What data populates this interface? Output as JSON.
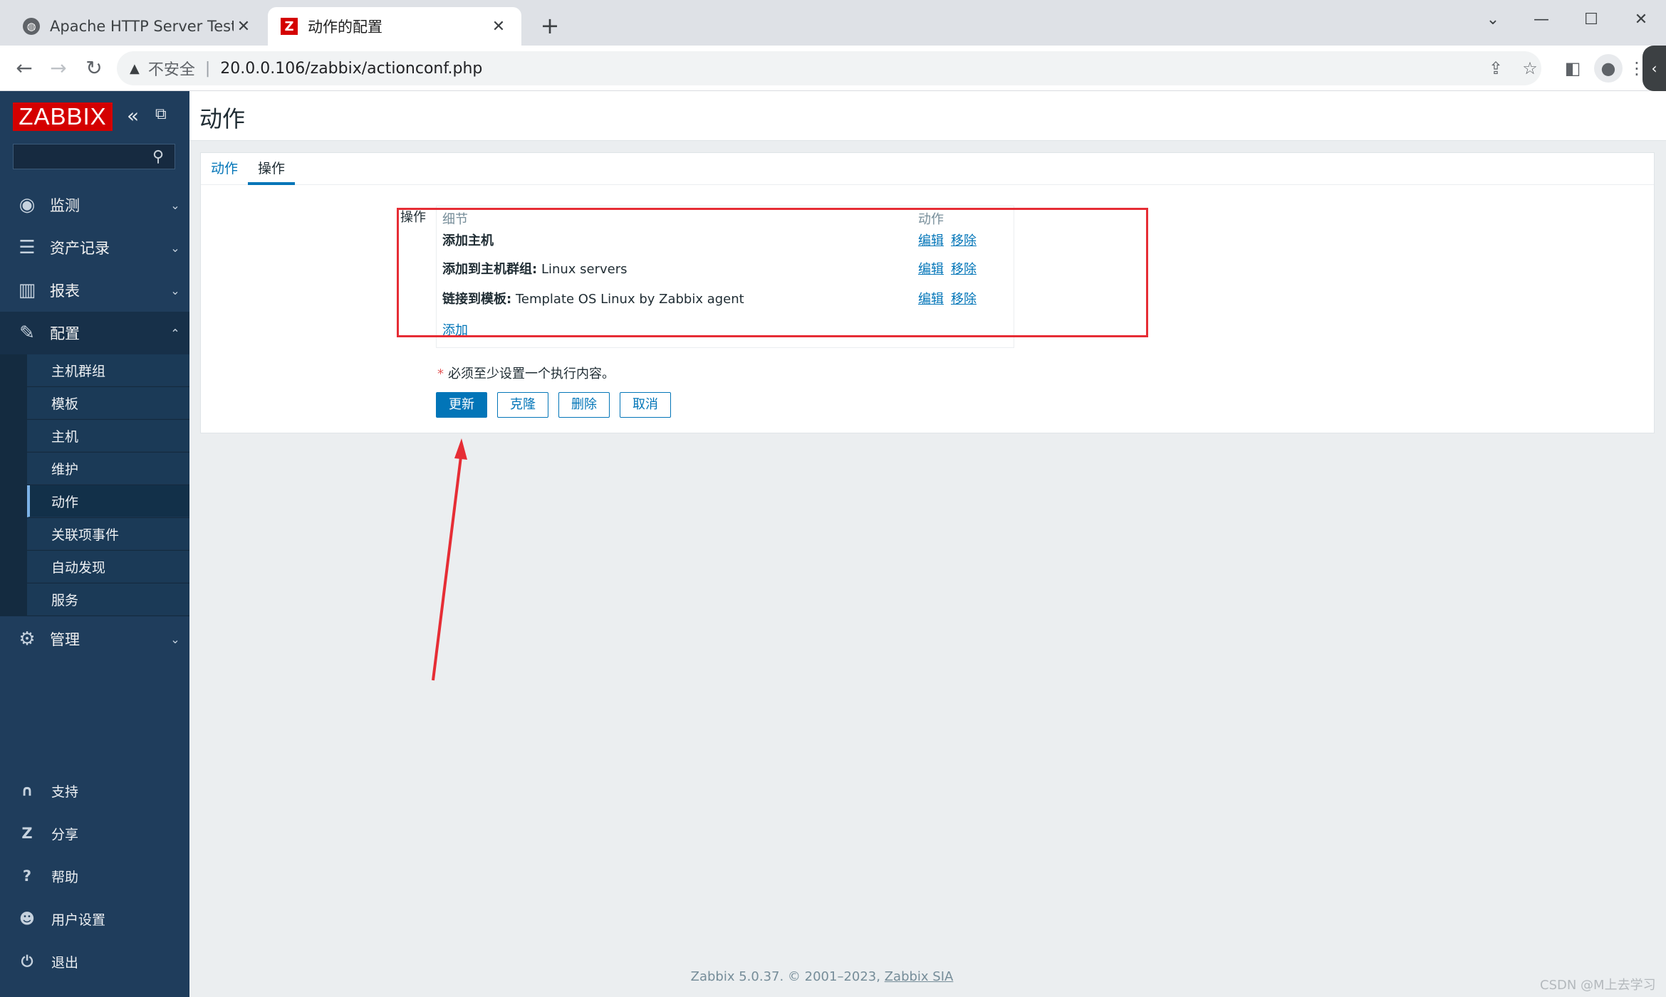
{
  "browser": {
    "tabs": [
      {
        "title": "Apache HTTP Server Test Page",
        "close": "✕"
      },
      {
        "title": "动作的配置",
        "close": "✕"
      }
    ],
    "new_tab": "+",
    "window_controls": {
      "minimize": "—",
      "maximize": "☐",
      "close": "✕",
      "dropdown": "⌄"
    },
    "address": {
      "warning_icon": "▲",
      "security": "不安全",
      "separator": "|",
      "url": "20.0.0.106/zabbix/actionconf.php"
    }
  },
  "sidebar": {
    "logo": "ZABBIX",
    "search_placeholder": "",
    "menu": [
      {
        "label": "监测"
      },
      {
        "label": "资产记录"
      },
      {
        "label": "报表"
      },
      {
        "label": "配置"
      },
      {
        "label": "管理"
      }
    ],
    "submenu": [
      {
        "label": "主机群组"
      },
      {
        "label": "模板"
      },
      {
        "label": "主机"
      },
      {
        "label": "维护"
      },
      {
        "label": "动作"
      },
      {
        "label": "关联项事件"
      },
      {
        "label": "自动发现"
      },
      {
        "label": "服务"
      }
    ],
    "footer": [
      {
        "label": "支持"
      },
      {
        "label": "分享"
      },
      {
        "label": "帮助"
      },
      {
        "label": "用户设置"
      },
      {
        "label": "退出"
      }
    ]
  },
  "page": {
    "title": "动作",
    "tabs": [
      {
        "label": "动作"
      },
      {
        "label": "操作"
      }
    ],
    "operations": {
      "label": "操作",
      "col_details": "细节",
      "col_action": "动作",
      "rows": [
        {
          "prefix": "添加主机",
          "value": ""
        },
        {
          "prefix": "添加到主机群组:",
          "value": "Linux servers"
        },
        {
          "prefix": "链接到模板:",
          "value": "Template OS Linux by Zabbix agent"
        }
      ],
      "edit": "编辑",
      "remove": "移除",
      "add": "添加"
    },
    "required_star": "*",
    "required_note": "必须至少设置一个执行内容。",
    "buttons": {
      "update": "更新",
      "clone": "克隆",
      "delete": "删除",
      "cancel": "取消"
    }
  },
  "footer": {
    "text": "Zabbix 5.0.37. © 2001–2023,",
    "company": "Zabbix SIA"
  },
  "watermark": "CSDN @M上去学习",
  "colors": {
    "brand_red": "#d40000",
    "sidebar": "#1f3d5c",
    "link": "#0275b8",
    "annotation": "#e62d35"
  }
}
